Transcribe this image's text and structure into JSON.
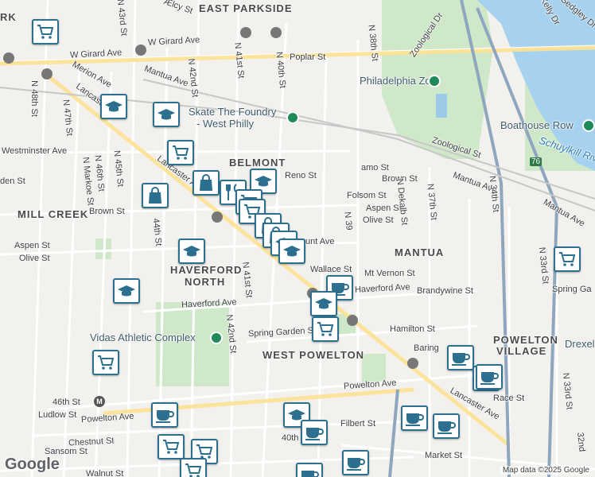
{
  "map": {
    "neighborhoods": [
      "EAST PARKSIDE",
      "BELMONT",
      "MILL CREEK",
      "HAVERFORD",
      "NORTH",
      "MANTUA",
      "POWELTON",
      "VILLAGE",
      "WEST POWELTON",
      "RK"
    ],
    "places": {
      "zoo": "Philadelphia Zoo",
      "skate": "Skate The Foundry",
      "skate2": "- West Philly",
      "boathouse": "Boathouse Row",
      "vidas": "Vidas Athletic Complex",
      "drexel": "Drexel",
      "river": "Schuylkill River"
    },
    "streets": {
      "girard": "W Girard Ave",
      "girard2": "W Girard Ave",
      "lancaster": "Lancaster Ave",
      "lancaster2": "Lancaster Ave",
      "lancaster3": "Lancaster Ave",
      "westminster": "Westminster Ave",
      "brown": "Brown St",
      "brown2": "Brown St",
      "aspen": "Aspen St",
      "aspen2": "Aspen St",
      "olive": "Olive St",
      "olive2": "Olive St",
      "haverford": "Haverford Ave",
      "haverford2": "Haverford Ave",
      "powelton": "Powelton Ave",
      "powelton2": "Powelton Ave",
      "chestnut": "Chestnut St",
      "walnut": "Walnut St",
      "sansom": "Sansom St",
      "ludlow": "Ludlow St",
      "market": "Market St",
      "filbert": "Filbert St",
      "spring": "Spring Garden St",
      "spring2": "Spring Ga",
      "hamilton": "Hamilton St",
      "wallace": "Wallace St",
      "mtvernon": "Mt Vernon St",
      "brandywine": "Brandywine St",
      "poplar": "Poplar St",
      "mantua": "Mantua Ave",
      "mantua2": "Mantua Ave",
      "mantua3": "Mantua Ave",
      "zoological": "Zoological St",
      "zoological2": "Zoological Dr",
      "reno": "Reno St",
      "folsom": "Folsom St",
      "race": "Race St",
      "baring": "Baring",
      "merion": "Merion Ave",
      "kelly": "Kelly Dr",
      "sedgley": "Sedgley Dr",
      "elcy": "Ælcy St",
      "mount": "unt Ave",
      "mamo": "amo St",
      "garden": "den St",
      "n48": "N 48th St",
      "n47": "N 47th St",
      "n46": "N 46th St",
      "n45": "N 45th St",
      "n44": "44th St",
      "n43": "N 43rd St",
      "n42": "N 42nd St",
      "n42b": "N 42nd St",
      "n41": "N 41st St",
      "n41b": "N 41st St",
      "n40": "N 40th St",
      "n39": "N 39",
      "n38": "N 38th St",
      "n37": "N 37th St",
      "dekalb": "N Dekalb St",
      "n34": "N 34th St",
      "n33": "N 33rd St",
      "n33b": "N 33rd St",
      "n32": "32nd",
      "markoe": "N Markoe St",
      "st46": "46th St",
      "st40": "40th",
      "i76": "76"
    },
    "markers": [
      {
        "type": "shopping-cart"
      },
      {
        "type": "education"
      },
      {
        "type": "education"
      },
      {
        "type": "shopping-cart"
      },
      {
        "type": "shopping-bag"
      },
      {
        "type": "education"
      },
      {
        "type": "shopping-bag"
      },
      {
        "type": "restaurant"
      },
      {
        "type": "education"
      },
      {
        "type": "shopping-cart"
      },
      {
        "type": "shopping-cart"
      },
      {
        "type": "shopping-bag"
      },
      {
        "type": "shopping-bag"
      },
      {
        "type": "education"
      },
      {
        "type": "education"
      },
      {
        "type": "education"
      },
      {
        "type": "cafe"
      },
      {
        "type": "education"
      },
      {
        "type": "shopping-cart"
      },
      {
        "type": "shopping-cart"
      },
      {
        "type": "cafe"
      },
      {
        "type": "cafe"
      },
      {
        "type": "cafe"
      },
      {
        "type": "education"
      },
      {
        "type": "cafe"
      },
      {
        "type": "cafe"
      },
      {
        "type": "cafe"
      },
      {
        "type": "shopping-cart"
      },
      {
        "type": "shopping-cart"
      },
      {
        "type": "shopping-cart"
      },
      {
        "type": "cafe"
      },
      {
        "type": "cafe"
      },
      {
        "type": "shopping-cart"
      },
      {
        "type": "cafe"
      }
    ],
    "logo": "Google",
    "attribution": "Map data ©2025 Google"
  }
}
